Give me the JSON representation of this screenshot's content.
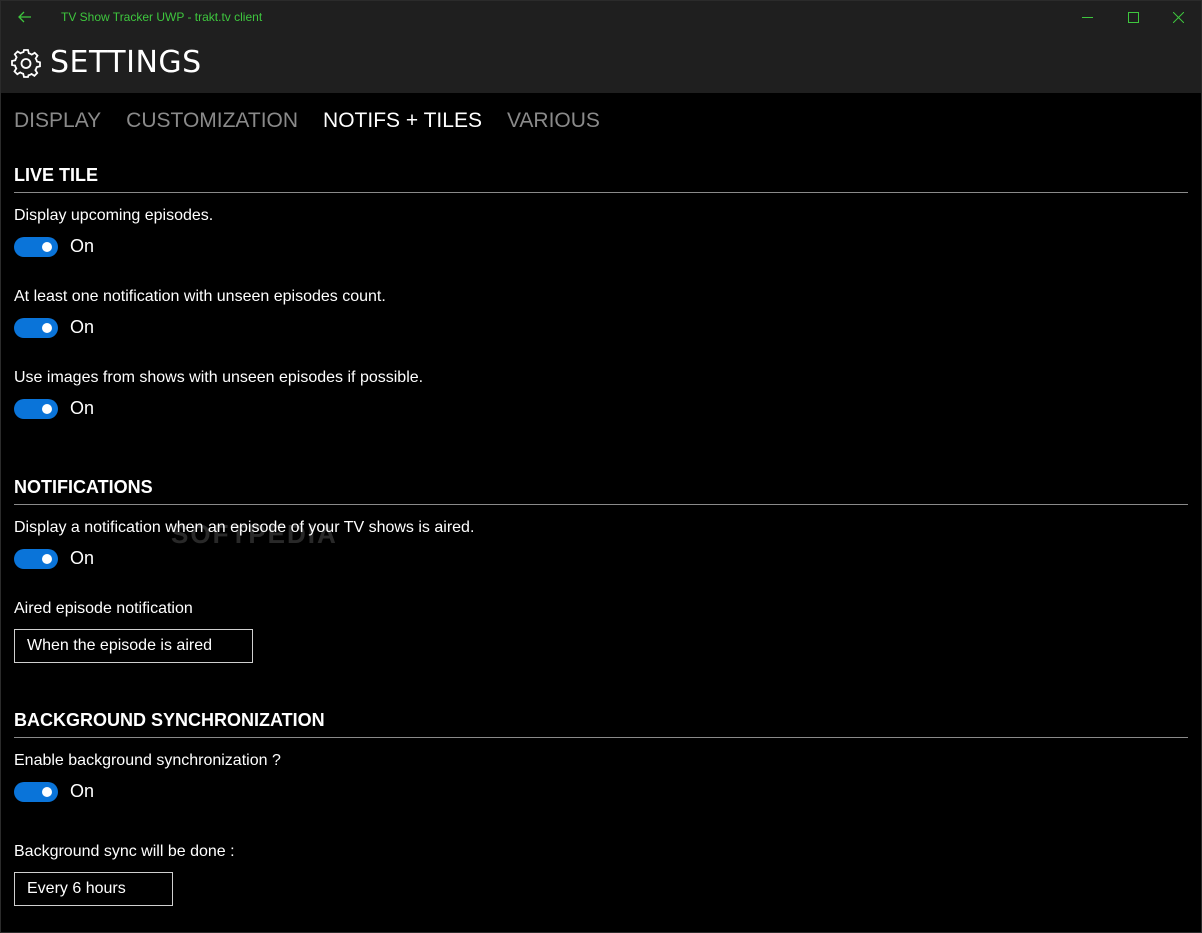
{
  "window": {
    "title": "TV Show Tracker UWP - trakt.tv client",
    "accent_color": "#3ec63e"
  },
  "header": {
    "title": "SETTINGS",
    "icon": "gear-icon"
  },
  "tabs": [
    {
      "label": "DISPLAY",
      "active": false
    },
    {
      "label": "CUSTOMIZATION",
      "active": false
    },
    {
      "label": "NOTIFS + TILES",
      "active": true
    },
    {
      "label": "VARIOUS",
      "active": false
    }
  ],
  "live_tile": {
    "title": "LIVE TILE",
    "upcoming": {
      "label": "Display upcoming episodes.",
      "state": "On"
    },
    "unseen_count": {
      "label": "At least one notification with unseen episodes count.",
      "state": "On"
    },
    "images": {
      "label": "Use images from shows with unseen episodes if possible.",
      "state": "On"
    }
  },
  "notifications": {
    "title": "NOTIFICATIONS",
    "aired": {
      "label": "Display a notification when an episode of your TV shows is aired.",
      "state": "On"
    },
    "aired_option": {
      "label": "Aired episode notification",
      "value": "When the episode is aired"
    }
  },
  "background_sync": {
    "title": "BACKGROUND SYNCHRONIZATION",
    "enable": {
      "label": "Enable background synchronization ?",
      "state": "On"
    },
    "frequency": {
      "label": "Background sync will be done :",
      "value": "Every 6 hours"
    }
  },
  "watermark": "SOFTPEDIA",
  "colors": {
    "toggle_on": "#0a74d9",
    "header_bg": "#1f1f1f",
    "inactive_tab": "#8a8a8a"
  }
}
